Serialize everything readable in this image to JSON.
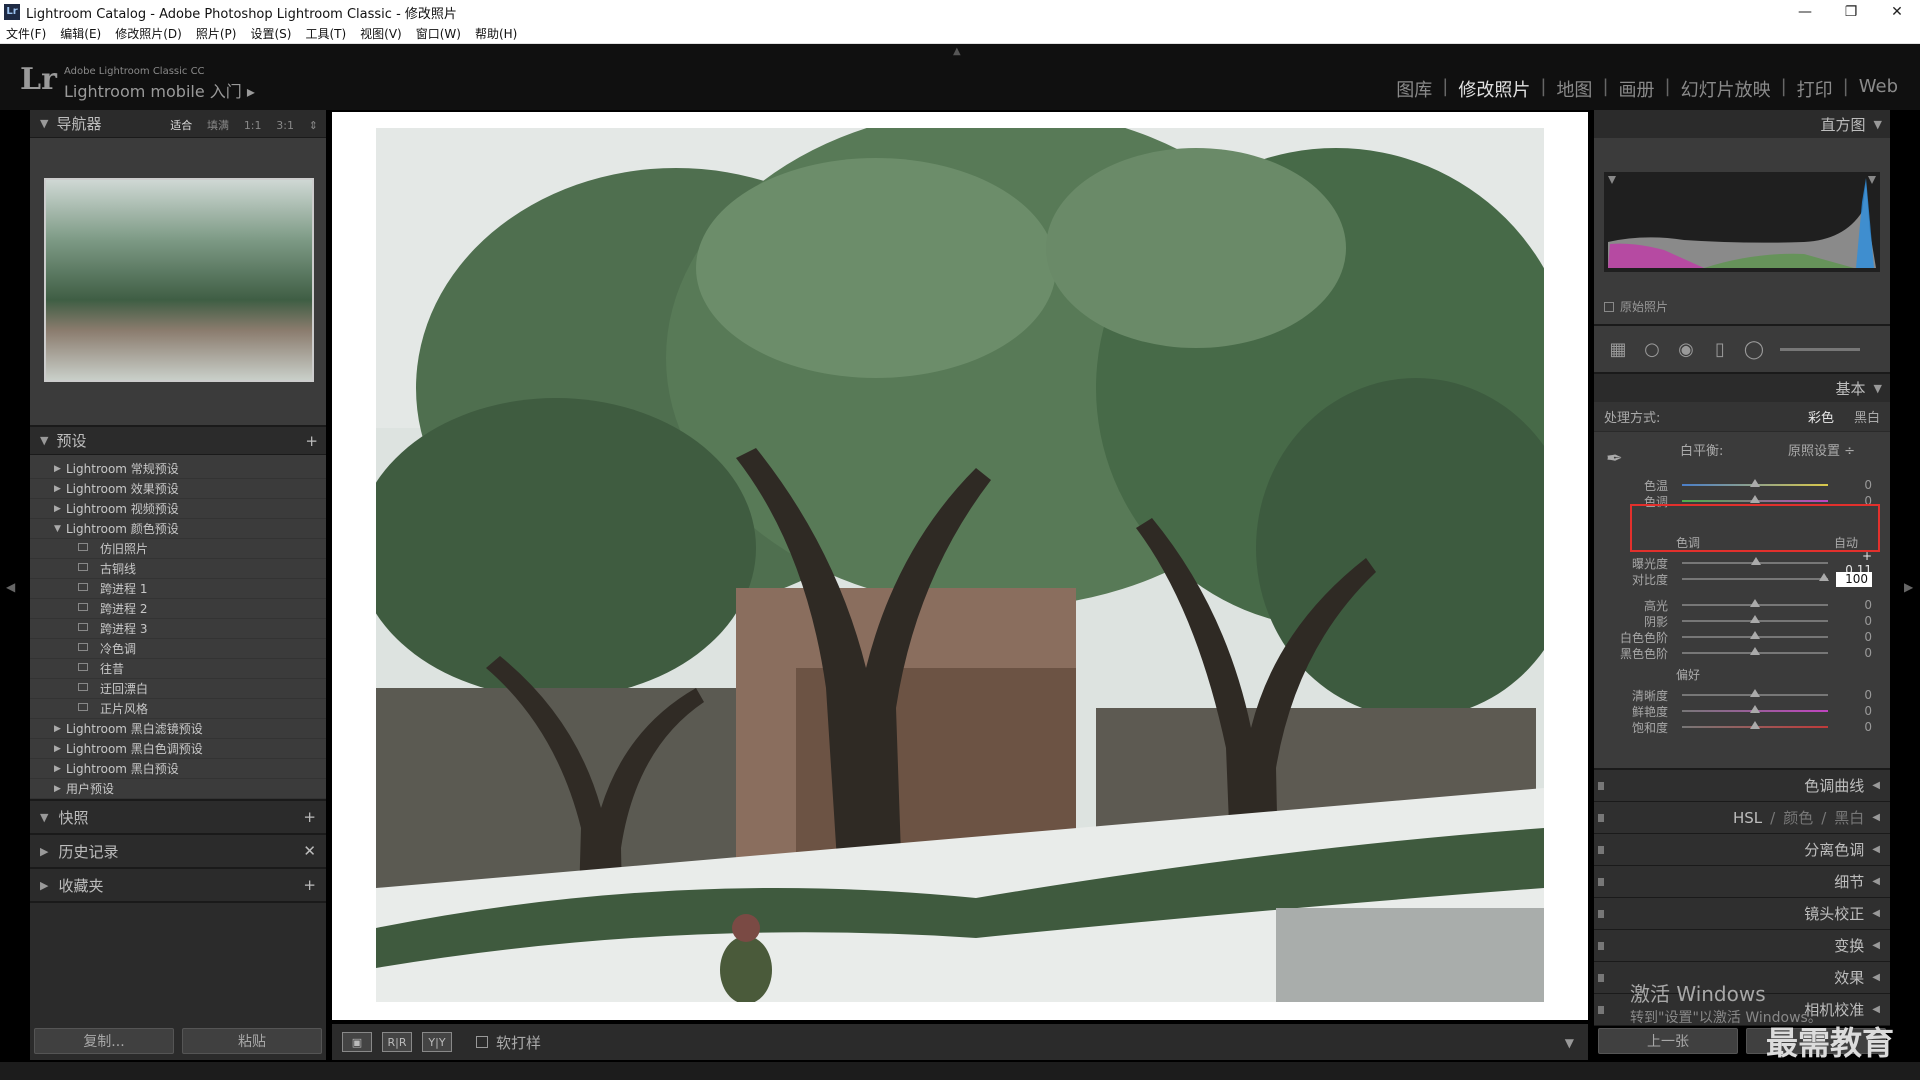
{
  "window": {
    "app_icon": "Lr",
    "title": "Lightroom Catalog - Adobe Photoshop Lightroom Classic - 修改照片"
  },
  "menu": [
    "文件(F)",
    "编辑(E)",
    "修改照片(D)",
    "照片(P)",
    "设置(S)",
    "工具(T)",
    "视图(V)",
    "窗口(W)",
    "帮助(H)"
  ],
  "identity": {
    "logo": "Lr",
    "product": "Adobe Lightroom Classic CC",
    "mobile": "Lightroom mobile 入门 ▸"
  },
  "modules": [
    "图库",
    "修改照片",
    "地图",
    "画册",
    "幻灯片放映",
    "打印",
    "Web"
  ],
  "active_module": "修改照片",
  "navigator": {
    "title": "导航器",
    "zoom": [
      "适合",
      "填满",
      "1:1",
      "3:1"
    ]
  },
  "presets": {
    "title": "预设",
    "items": [
      {
        "label": "Lightroom 常规预设",
        "expanded": false
      },
      {
        "label": "Lightroom 效果预设",
        "expanded": false
      },
      {
        "label": "Lightroom 视频预设",
        "expanded": false
      },
      {
        "label": "Lightroom 颜色预设",
        "expanded": true
      },
      {
        "label": "仿旧照片",
        "child": true
      },
      {
        "label": "古铜线",
        "child": true
      },
      {
        "label": "跨进程 1",
        "child": true
      },
      {
        "label": "跨进程 2",
        "child": true
      },
      {
        "label": "跨进程 3",
        "child": true
      },
      {
        "label": "冷色调",
        "child": true
      },
      {
        "label": "往昔",
        "child": true
      },
      {
        "label": "迂回漂白",
        "child": true
      },
      {
        "label": "正片风格",
        "child": true
      },
      {
        "label": "Lightroom 黑白滤镜预设",
        "expanded": false
      },
      {
        "label": "Lightroom 黑白色调预设",
        "expanded": false
      },
      {
        "label": "Lightroom 黑白预设",
        "expanded": false
      },
      {
        "label": "用户预设",
        "expanded": false
      }
    ]
  },
  "snapshots": {
    "title": "快照"
  },
  "history": {
    "title": "历史记录"
  },
  "collections": {
    "title": "收藏夹"
  },
  "left_buttons": {
    "copy": "复制...",
    "paste": "粘贴"
  },
  "toolbar": {
    "soft_proof": "软打样",
    "view_ab": "R|R",
    "view_yy": "Y|Y"
  },
  "right": {
    "histogram": "直方图",
    "original_photo": "原始照片",
    "basic": "基本",
    "treatment_label": "处理方式:",
    "treatment_color": "彩色",
    "treatment_bw": "黑白",
    "wb_label": "白平衡:",
    "wb_value": "原照设置 ÷",
    "tone_label": "色调",
    "auto": "自动",
    "presence_label": "偏好",
    "sliders": {
      "temp": {
        "label": "色温",
        "value": "0",
        "pos": 0.5
      },
      "tint": {
        "label": "色调",
        "value": "0",
        "pos": 0.5
      },
      "exposure": {
        "label": "曝光度",
        "value": "+ 0.11",
        "pos": 0.51
      },
      "contrast": {
        "label": "对比度",
        "value": "100",
        "pos": 0.97
      },
      "highlights": {
        "label": "高光",
        "value": "0",
        "pos": 0.5
      },
      "shadows": {
        "label": "阴影",
        "value": "0",
        "pos": 0.5
      },
      "whites": {
        "label": "白色色阶",
        "value": "0",
        "pos": 0.5
      },
      "blacks": {
        "label": "黑色色阶",
        "value": "0",
        "pos": 0.5
      },
      "clarity": {
        "label": "清晰度",
        "value": "0",
        "pos": 0.5
      },
      "vibrance": {
        "label": "鲜艳度",
        "value": "0",
        "pos": 0.5
      },
      "saturation": {
        "label": "饱和度",
        "value": "0",
        "pos": 0.5
      }
    },
    "panels": {
      "tone_curve": "色调曲线",
      "hsl": "HSL",
      "hsl_color": "颜色",
      "hsl_bw": "黑白",
      "split": "分离色调",
      "detail": "细节",
      "lens": "镜头校正",
      "transform": "变换",
      "effects": "效果",
      "calibration": "相机校准"
    },
    "prev_button": "上一张"
  },
  "watermark": {
    "line1": "激活 Windows",
    "line2": "转到\"设置\"以激活 Windows。"
  },
  "brand": "最需教育",
  "colors": {
    "highlight": "#e2302c",
    "panel": "#3b3b3b"
  }
}
